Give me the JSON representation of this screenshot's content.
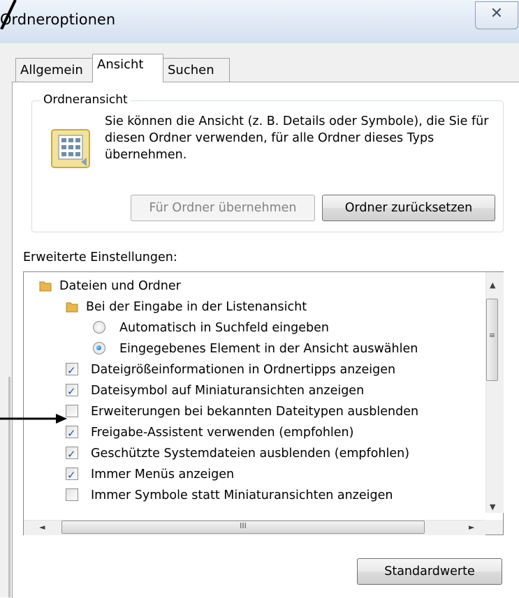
{
  "window": {
    "title": "Ordneroptionen",
    "close_glyph": "✕",
    "close_icon": "close-icon"
  },
  "tabs": [
    {
      "label": "Allgemein",
      "active": false
    },
    {
      "label": "Ansicht",
      "active": true
    },
    {
      "label": "Suchen",
      "active": false
    }
  ],
  "folder_view": {
    "group_title": "Ordneransicht",
    "description": "Sie können die Ansicht (z. B. Details oder Symbole), die Sie für diesen Ordner verwenden, für alle Ordner dieses Typs übernehmen.",
    "apply_button": "Für Ordner übernehmen",
    "reset_button": "Ordner zurücksetzen",
    "icon": "folder-view-icon"
  },
  "advanced": {
    "label": "Erweiterte Einstellungen:",
    "items": [
      {
        "type": "folder",
        "label": "Dateien und Ordner"
      },
      {
        "type": "folder",
        "label": "Bei der Eingabe in der Listenansicht"
      },
      {
        "type": "radio",
        "label": "Automatisch in Suchfeld eingeben",
        "checked": false
      },
      {
        "type": "radio",
        "label": "Eingegebenes Element in der Ansicht auswählen",
        "checked": true
      },
      {
        "type": "checkbox",
        "label": "Dateigrößeinformationen in Ordnertipps anzeigen",
        "checked": true
      },
      {
        "type": "checkbox",
        "label": "Dateisymbol auf Miniaturansichten anzeigen",
        "checked": true
      },
      {
        "type": "checkbox",
        "label": "Erweiterungen bei bekannten Dateitypen ausblenden",
        "checked": false
      },
      {
        "type": "checkbox",
        "label": "Freigabe-Assistent verwenden (empfohlen)",
        "checked": true
      },
      {
        "type": "checkbox",
        "label": "Geschützte Systemdateien ausblenden (empfohlen)",
        "checked": true
      },
      {
        "type": "checkbox",
        "label": "Immer Menüs anzeigen",
        "checked": true
      },
      {
        "type": "checkbox",
        "label": "Immer Symbole statt Miniaturansichten anzeigen",
        "checked": false
      }
    ]
  },
  "scrollbars": {
    "vertical_grip": "≡",
    "horizontal_grip": "III",
    "up_arrow": "▲",
    "down_arrow": "▼",
    "left_arrow": "◄",
    "right_arrow": "►"
  },
  "defaults_button": "Standardwerte",
  "colors": {
    "accent": "#2256b6",
    "titlebar": "#dfe9f5",
    "annotation_arrow": "#000000"
  }
}
